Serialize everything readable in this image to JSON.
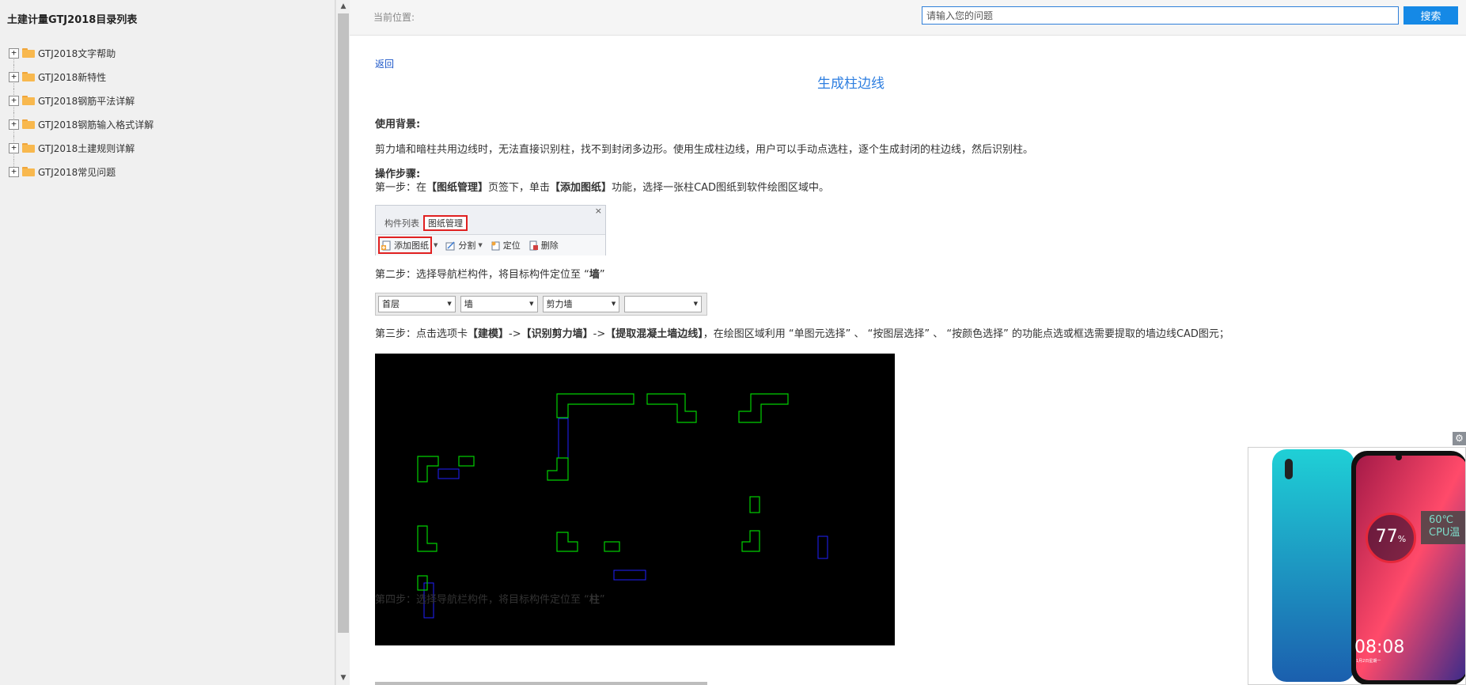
{
  "sidebar": {
    "title": "土建计量GTJ2018目录列表",
    "items": [
      {
        "label": "GTJ2018文字帮助"
      },
      {
        "label": "GTJ2018新特性"
      },
      {
        "label": "GTJ2018钢筋平法详解"
      },
      {
        "label": "GTJ2018钢筋输入格式详解"
      },
      {
        "label": "GTJ2018土建规则详解"
      },
      {
        "label": "GTJ2018常见问题"
      }
    ]
  },
  "header": {
    "location_label": "当前位置:",
    "search_placeholder": "请输入您的问题",
    "search_button": "搜索"
  },
  "article": {
    "back_link": "返回",
    "title": "生成柱边线",
    "background_heading": "使用背景:",
    "background_text": "剪力墙和暗柱共用边线时，无法直接识别柱，找不到封闭多边形。使用生成柱边线，用户可以手动点选柱，逐个生成封闭的柱边线，然后识别柱。",
    "steps_heading": "操作步骤:",
    "step1": {
      "prefix": "第一步：在",
      "b1": "【图纸管理】",
      "mid": "页签下，单击",
      "b2": "【添加图纸】",
      "suffix": "功能，选择一张柱CAD图纸到软件绘图区域中。"
    },
    "step2": {
      "prefix": "第二步：选择导航栏构件，将目标构件定位至 “",
      "b": "墙",
      "suffix": "”"
    },
    "step3": {
      "prefix": "第三步：点击选项卡",
      "b1": "【建模】",
      "s1": "->",
      "b2": "【识别剪力墙】",
      "s2": "->",
      "b3": "【提取混凝土墙边线】",
      "suffix": "，在绘图区域利用 “单图元选择” 、 “按图层选择” 、 “按颜色选择” 的功能点选或框选需要提取的墙边线CAD图元；"
    },
    "step4": {
      "prefix": "第四步：选择导航栏构件，将目标构件定位至 “",
      "b": "柱",
      "suffix": "”"
    }
  },
  "figure1": {
    "close": "×",
    "tabs": [
      "构件列表",
      "图纸管理"
    ],
    "tools": [
      "添加图纸",
      "分割",
      "定位",
      "删除"
    ]
  },
  "figure2": {
    "combos": [
      "首层",
      "墙",
      "剪力墙",
      ""
    ]
  },
  "ad": {
    "percent": "77",
    "percent_unit": "%",
    "temp": "60℃",
    "temp_label": "CPU温",
    "time": "08:08",
    "date": "1月2日星期一"
  },
  "colors": {
    "accent": "#1589e6",
    "title": "#2d7ee0",
    "highlight": "#e02020",
    "cad_green": "#00e000",
    "cad_blue": "#2020ff"
  }
}
